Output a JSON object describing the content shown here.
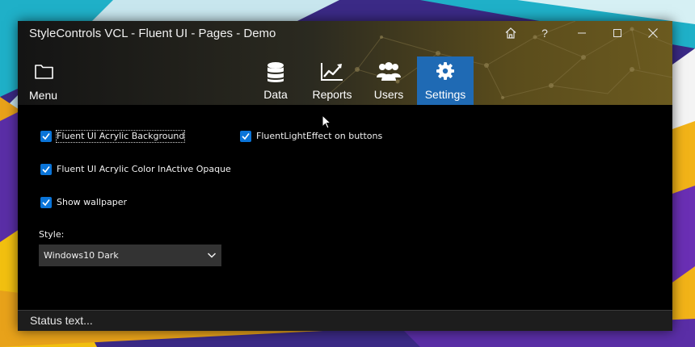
{
  "window": {
    "title": "StyleControls VCL - Fluent UI - Pages - Demo"
  },
  "caption_buttons": [
    {
      "name": "home-icon"
    },
    {
      "name": "help-icon",
      "label": "?"
    },
    {
      "name": "minimize-icon"
    },
    {
      "name": "maximize-icon"
    },
    {
      "name": "close-icon"
    }
  ],
  "menu": {
    "label": "Menu",
    "icon": "folder-icon"
  },
  "nav": {
    "items": [
      {
        "label": "Data",
        "icon": "database-icon"
      },
      {
        "label": "Reports",
        "icon": "chart-line-icon"
      },
      {
        "label": "Users",
        "icon": "users-icon"
      },
      {
        "label": "Settings",
        "icon": "gear-icon",
        "active": true
      }
    ]
  },
  "settings": {
    "options": [
      {
        "label": "Fluent UI Acrylic Background",
        "checked": true
      },
      {
        "label": "Fluent UI Acrylic Color InActive Opaque",
        "checked": true
      },
      {
        "label": "Show wallpaper",
        "checked": true
      },
      {
        "label": "FluentLightEffect on buttons",
        "checked": true
      }
    ],
    "style_label": "Style:",
    "style_value": "Windows10 Dark"
  },
  "status": {
    "text": "Status text..."
  },
  "colors": {
    "accent": "#1f6ab4",
    "checkbox": "#0a74d8",
    "window_bg": "#000000"
  }
}
